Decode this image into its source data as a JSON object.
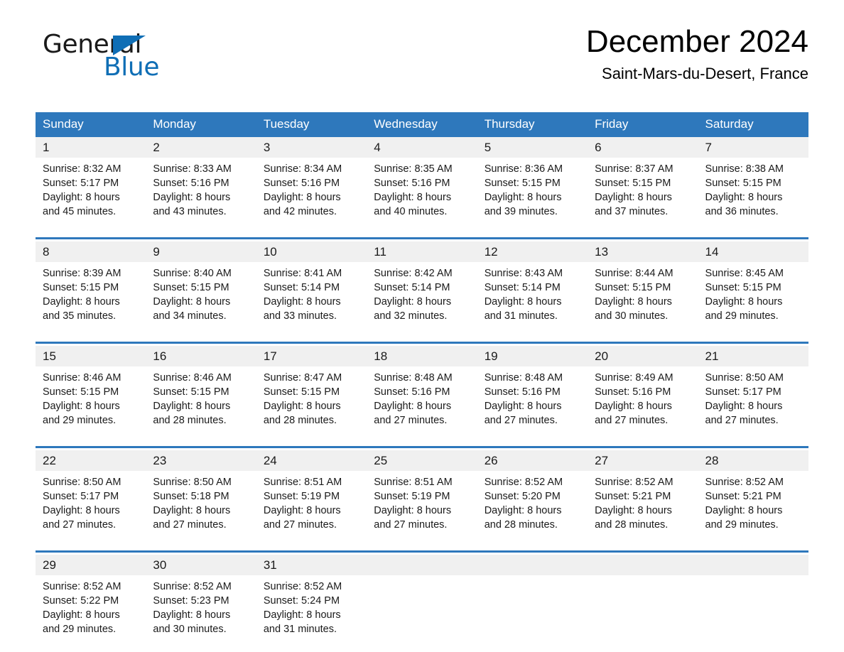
{
  "brand": {
    "word_one": "General",
    "word_two": "Blue",
    "flag_icon": "triangle-flag-icon",
    "accent_color": "#0f6eb5"
  },
  "header": {
    "month_title": "December 2024",
    "location": "Saint-Mars-du-Desert, France"
  },
  "calendar": {
    "header_bg": "#2e78bc",
    "daynum_bg": "#f0f0f0",
    "weekday_headers": [
      "Sunday",
      "Monday",
      "Tuesday",
      "Wednesday",
      "Thursday",
      "Friday",
      "Saturday"
    ],
    "weeks": [
      [
        {
          "day": "1",
          "sunrise": "Sunrise: 8:32 AM",
          "sunset": "Sunset: 5:17 PM",
          "daylight_line1": "Daylight: 8 hours",
          "daylight_line2": "and 45 minutes."
        },
        {
          "day": "2",
          "sunrise": "Sunrise: 8:33 AM",
          "sunset": "Sunset: 5:16 PM",
          "daylight_line1": "Daylight: 8 hours",
          "daylight_line2": "and 43 minutes."
        },
        {
          "day": "3",
          "sunrise": "Sunrise: 8:34 AM",
          "sunset": "Sunset: 5:16 PM",
          "daylight_line1": "Daylight: 8 hours",
          "daylight_line2": "and 42 minutes."
        },
        {
          "day": "4",
          "sunrise": "Sunrise: 8:35 AM",
          "sunset": "Sunset: 5:16 PM",
          "daylight_line1": "Daylight: 8 hours",
          "daylight_line2": "and 40 minutes."
        },
        {
          "day": "5",
          "sunrise": "Sunrise: 8:36 AM",
          "sunset": "Sunset: 5:15 PM",
          "daylight_line1": "Daylight: 8 hours",
          "daylight_line2": "and 39 minutes."
        },
        {
          "day": "6",
          "sunrise": "Sunrise: 8:37 AM",
          "sunset": "Sunset: 5:15 PM",
          "daylight_line1": "Daylight: 8 hours",
          "daylight_line2": "and 37 minutes."
        },
        {
          "day": "7",
          "sunrise": "Sunrise: 8:38 AM",
          "sunset": "Sunset: 5:15 PM",
          "daylight_line1": "Daylight: 8 hours",
          "daylight_line2": "and 36 minutes."
        }
      ],
      [
        {
          "day": "8",
          "sunrise": "Sunrise: 8:39 AM",
          "sunset": "Sunset: 5:15 PM",
          "daylight_line1": "Daylight: 8 hours",
          "daylight_line2": "and 35 minutes."
        },
        {
          "day": "9",
          "sunrise": "Sunrise: 8:40 AM",
          "sunset": "Sunset: 5:15 PM",
          "daylight_line1": "Daylight: 8 hours",
          "daylight_line2": "and 34 minutes."
        },
        {
          "day": "10",
          "sunrise": "Sunrise: 8:41 AM",
          "sunset": "Sunset: 5:14 PM",
          "daylight_line1": "Daylight: 8 hours",
          "daylight_line2": "and 33 minutes."
        },
        {
          "day": "11",
          "sunrise": "Sunrise: 8:42 AM",
          "sunset": "Sunset: 5:14 PM",
          "daylight_line1": "Daylight: 8 hours",
          "daylight_line2": "and 32 minutes."
        },
        {
          "day": "12",
          "sunrise": "Sunrise: 8:43 AM",
          "sunset": "Sunset: 5:14 PM",
          "daylight_line1": "Daylight: 8 hours",
          "daylight_line2": "and 31 minutes."
        },
        {
          "day": "13",
          "sunrise": "Sunrise: 8:44 AM",
          "sunset": "Sunset: 5:15 PM",
          "daylight_line1": "Daylight: 8 hours",
          "daylight_line2": "and 30 minutes."
        },
        {
          "day": "14",
          "sunrise": "Sunrise: 8:45 AM",
          "sunset": "Sunset: 5:15 PM",
          "daylight_line1": "Daylight: 8 hours",
          "daylight_line2": "and 29 minutes."
        }
      ],
      [
        {
          "day": "15",
          "sunrise": "Sunrise: 8:46 AM",
          "sunset": "Sunset: 5:15 PM",
          "daylight_line1": "Daylight: 8 hours",
          "daylight_line2": "and 29 minutes."
        },
        {
          "day": "16",
          "sunrise": "Sunrise: 8:46 AM",
          "sunset": "Sunset: 5:15 PM",
          "daylight_line1": "Daylight: 8 hours",
          "daylight_line2": "and 28 minutes."
        },
        {
          "day": "17",
          "sunrise": "Sunrise: 8:47 AM",
          "sunset": "Sunset: 5:15 PM",
          "daylight_line1": "Daylight: 8 hours",
          "daylight_line2": "and 28 minutes."
        },
        {
          "day": "18",
          "sunrise": "Sunrise: 8:48 AM",
          "sunset": "Sunset: 5:16 PM",
          "daylight_line1": "Daylight: 8 hours",
          "daylight_line2": "and 27 minutes."
        },
        {
          "day": "19",
          "sunrise": "Sunrise: 8:48 AM",
          "sunset": "Sunset: 5:16 PM",
          "daylight_line1": "Daylight: 8 hours",
          "daylight_line2": "and 27 minutes."
        },
        {
          "day": "20",
          "sunrise": "Sunrise: 8:49 AM",
          "sunset": "Sunset: 5:16 PM",
          "daylight_line1": "Daylight: 8 hours",
          "daylight_line2": "and 27 minutes."
        },
        {
          "day": "21",
          "sunrise": "Sunrise: 8:50 AM",
          "sunset": "Sunset: 5:17 PM",
          "daylight_line1": "Daylight: 8 hours",
          "daylight_line2": "and 27 minutes."
        }
      ],
      [
        {
          "day": "22",
          "sunrise": "Sunrise: 8:50 AM",
          "sunset": "Sunset: 5:17 PM",
          "daylight_line1": "Daylight: 8 hours",
          "daylight_line2": "and 27 minutes."
        },
        {
          "day": "23",
          "sunrise": "Sunrise: 8:50 AM",
          "sunset": "Sunset: 5:18 PM",
          "daylight_line1": "Daylight: 8 hours",
          "daylight_line2": "and 27 minutes."
        },
        {
          "day": "24",
          "sunrise": "Sunrise: 8:51 AM",
          "sunset": "Sunset: 5:19 PM",
          "daylight_line1": "Daylight: 8 hours",
          "daylight_line2": "and 27 minutes."
        },
        {
          "day": "25",
          "sunrise": "Sunrise: 8:51 AM",
          "sunset": "Sunset: 5:19 PM",
          "daylight_line1": "Daylight: 8 hours",
          "daylight_line2": "and 27 minutes."
        },
        {
          "day": "26",
          "sunrise": "Sunrise: 8:52 AM",
          "sunset": "Sunset: 5:20 PM",
          "daylight_line1": "Daylight: 8 hours",
          "daylight_line2": "and 28 minutes."
        },
        {
          "day": "27",
          "sunrise": "Sunrise: 8:52 AM",
          "sunset": "Sunset: 5:21 PM",
          "daylight_line1": "Daylight: 8 hours",
          "daylight_line2": "and 28 minutes."
        },
        {
          "day": "28",
          "sunrise": "Sunrise: 8:52 AM",
          "sunset": "Sunset: 5:21 PM",
          "daylight_line1": "Daylight: 8 hours",
          "daylight_line2": "and 29 minutes."
        }
      ],
      [
        {
          "day": "29",
          "sunrise": "Sunrise: 8:52 AM",
          "sunset": "Sunset: 5:22 PM",
          "daylight_line1": "Daylight: 8 hours",
          "daylight_line2": "and 29 minutes."
        },
        {
          "day": "30",
          "sunrise": "Sunrise: 8:52 AM",
          "sunset": "Sunset: 5:23 PM",
          "daylight_line1": "Daylight: 8 hours",
          "daylight_line2": "and 30 minutes."
        },
        {
          "day": "31",
          "sunrise": "Sunrise: 8:52 AM",
          "sunset": "Sunset: 5:24 PM",
          "daylight_line1": "Daylight: 8 hours",
          "daylight_line2": "and 31 minutes."
        },
        {
          "day": "",
          "sunrise": "",
          "sunset": "",
          "daylight_line1": "",
          "daylight_line2": ""
        },
        {
          "day": "",
          "sunrise": "",
          "sunset": "",
          "daylight_line1": "",
          "daylight_line2": ""
        },
        {
          "day": "",
          "sunrise": "",
          "sunset": "",
          "daylight_line1": "",
          "daylight_line2": ""
        },
        {
          "day": "",
          "sunrise": "",
          "sunset": "",
          "daylight_line1": "",
          "daylight_line2": ""
        }
      ]
    ]
  }
}
